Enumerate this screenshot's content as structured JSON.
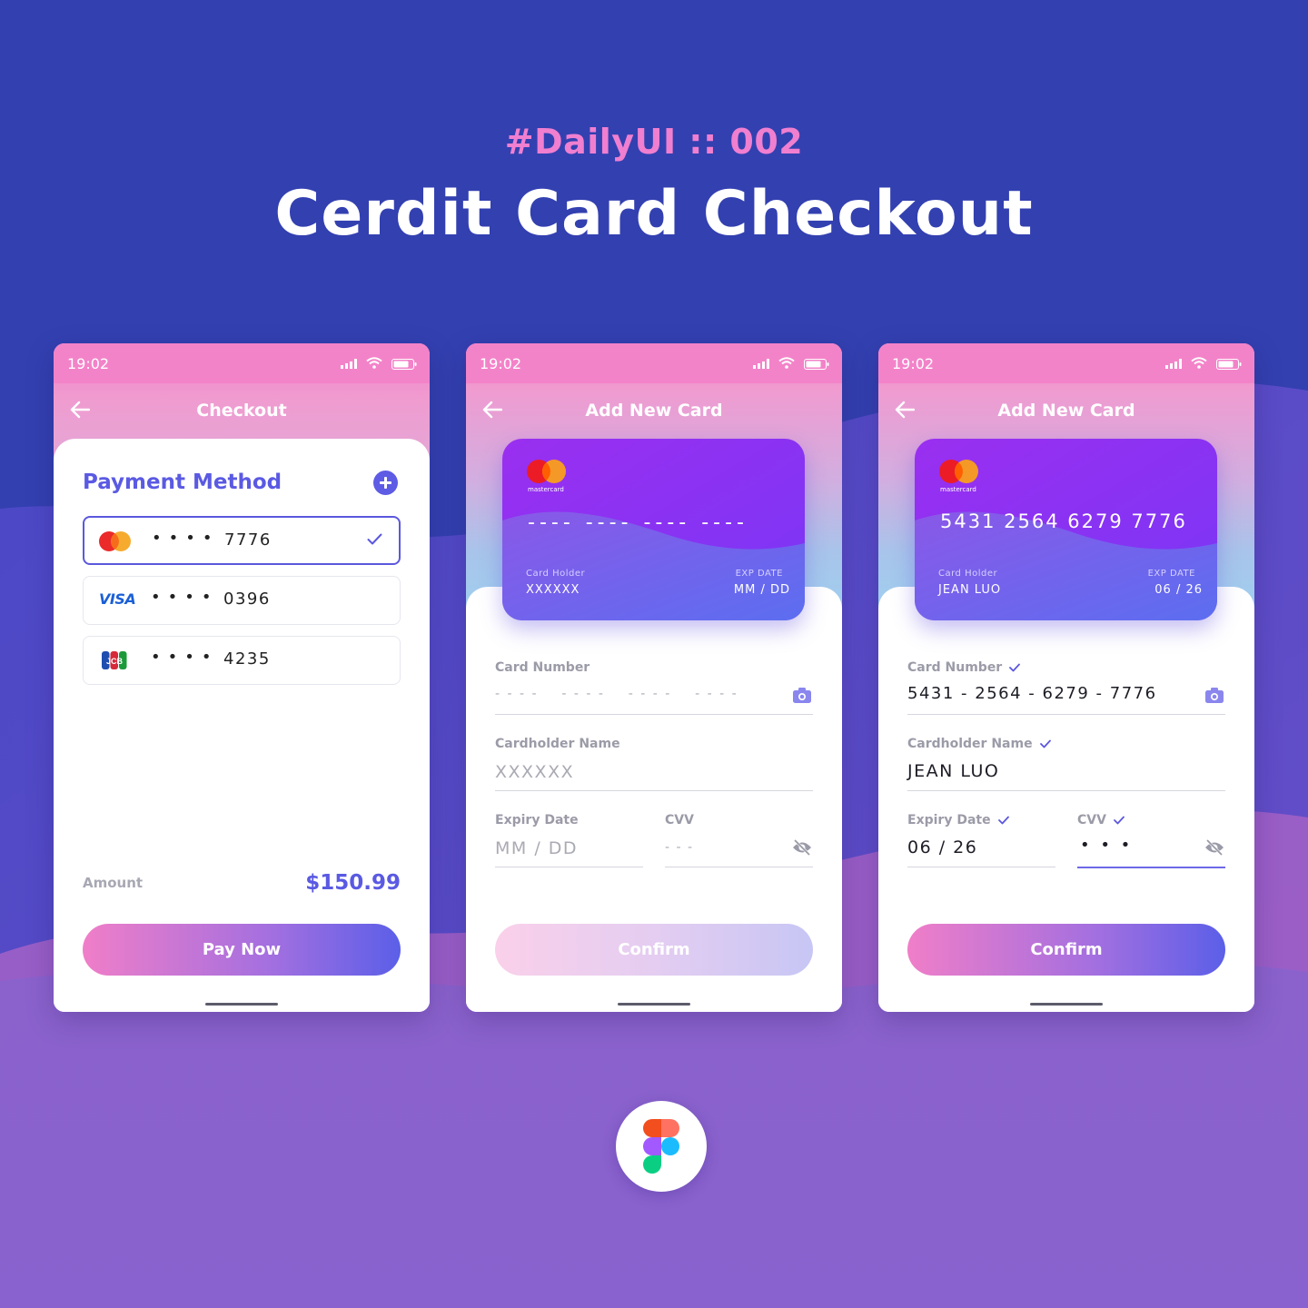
{
  "hero": {
    "tag": "#DailyUI :: 002",
    "title": "Cerdit Card Checkout"
  },
  "colors": {
    "background": "#3340b0",
    "accent": "#5a5ae3",
    "pink": "#f07fd0",
    "button_start": "#f07ec8",
    "button_end": "#5b5fe8"
  },
  "screens": [
    {
      "status_time": "19:02",
      "nav_title": "Checkout",
      "section_title": "Payment Method",
      "cards": [
        {
          "brand": "mastercard-icon",
          "dots": "••••",
          "last4": "7776",
          "selected": true
        },
        {
          "brand": "visa-icon",
          "logo_text": "VISA",
          "dots": "••••",
          "last4": "0396",
          "selected": false
        },
        {
          "brand": "jcb-icon",
          "dots": "••••",
          "last4": "4235",
          "selected": false
        }
      ],
      "amount_label": "Amount",
      "amount": "$150.99",
      "button": "Pay Now"
    },
    {
      "status_time": "19:02",
      "nav_title": "Add New Card",
      "card_preview": {
        "brand_text": "mastercard",
        "number": "---- ---- ---- ----",
        "holder_label": "Card Holder",
        "holder": "XXXXXX",
        "exp_label": "EXP DATE",
        "exp": "MM / DD"
      },
      "fields": {
        "card_number_label": "Card Number",
        "card_number_placeholder": "- - - -    - - - -    - - - -    - - - -",
        "holder_label": "Cardholder Name",
        "holder_placeholder": "XXXXXX",
        "expiry_label": "Expiry Date",
        "expiry_placeholder": "MM / DD",
        "cvv_label": "CVV",
        "cvv_placeholder": "- - -"
      },
      "button": "Confirm",
      "button_enabled": false
    },
    {
      "status_time": "19:02",
      "nav_title": "Add New Card",
      "card_preview": {
        "brand_text": "mastercard",
        "number": "5431 2564 6279 7776",
        "holder_label": "Card Holder",
        "holder": "JEAN LUO",
        "exp_label": "EXP DATE",
        "exp": "06 / 26"
      },
      "fields": {
        "card_number_label": "Card Number",
        "card_number_value": "5431 - 2564 - 6279 - 7776",
        "holder_label": "Cardholder Name",
        "holder_value": "JEAN LUO",
        "expiry_label": "Expiry Date",
        "expiry_value": "06 / 26",
        "cvv_label": "CVV",
        "cvv_value": "• • •"
      },
      "button": "Confirm",
      "button_enabled": true
    }
  ],
  "footer_logo": "figma-logo-icon"
}
